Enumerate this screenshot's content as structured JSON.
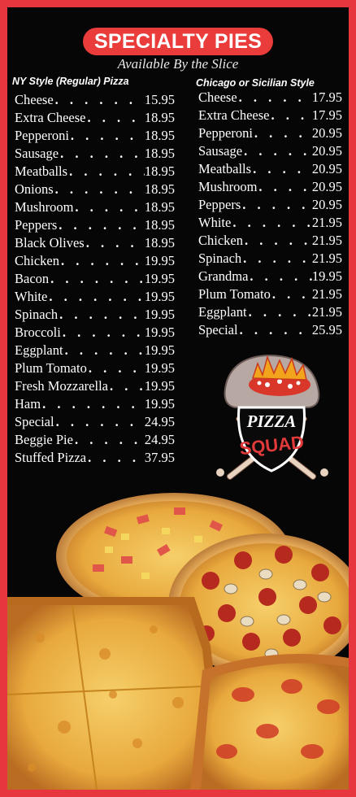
{
  "header": {
    "title": "SPECIALTY PIES",
    "subtitle": "Available By the Slice"
  },
  "ny_style": {
    "heading": "NY Style (Regular) Pizza",
    "items": [
      {
        "name": "Cheese",
        "price": "15.95"
      },
      {
        "name": "Extra Cheese",
        "price": "18.95"
      },
      {
        "name": "Pepperoni",
        "price": "18.95"
      },
      {
        "name": "Sausage",
        "price": "18.95"
      },
      {
        "name": "Meatballs",
        "price": "18.95"
      },
      {
        "name": "Onions",
        "price": "18.95"
      },
      {
        "name": "Mushroom",
        "price": "18.95"
      },
      {
        "name": "Peppers",
        "price": "18.95"
      },
      {
        "name": "Black Olives",
        "price": "18.95"
      },
      {
        "name": "Chicken",
        "price": "19.95"
      },
      {
        "name": "Bacon",
        "price": "19.95"
      },
      {
        "name": "White",
        "price": "19.95"
      },
      {
        "name": "Spinach",
        "price": "19.95"
      },
      {
        "name": "Broccoli",
        "price": "19.95"
      },
      {
        "name": "Eggplant",
        "price": "19.95"
      },
      {
        "name": "Plum Tomato",
        "price": "19.95"
      },
      {
        "name": "Fresh Mozzarella",
        "price": "19.95"
      },
      {
        "name": "Ham",
        "price": "19.95"
      },
      {
        "name": "Special",
        "price": "24.95"
      },
      {
        "name": "Beggie Pie",
        "price": "24.95"
      },
      {
        "name": "Stuffed Pizza",
        "price": "37.95"
      }
    ]
  },
  "chicago_style": {
    "heading": "Chicago or Sicilian Style",
    "items": [
      {
        "name": "Cheese",
        "price": "17.95"
      },
      {
        "name": "Extra Cheese",
        "price": "17.95"
      },
      {
        "name": "Pepperoni",
        "price": "20.95"
      },
      {
        "name": "Sausage",
        "price": "20.95"
      },
      {
        "name": "Meatballs",
        "price": "20.95"
      },
      {
        "name": "Mushroom",
        "price": "20.95"
      },
      {
        "name": "Peppers",
        "price": "20.95"
      },
      {
        "name": "White",
        "price": "21.95"
      },
      {
        "name": "Chicken",
        "price": "21.95"
      },
      {
        "name": "Spinach",
        "price": "21.95"
      },
      {
        "name": "Grandma",
        "price": "19.95"
      },
      {
        "name": "Plum Tomato",
        "price": "21.95"
      },
      {
        "name": "Eggplant",
        "price": "21.95"
      },
      {
        "name": "Special",
        "price": "25.95"
      }
    ]
  },
  "logo": {
    "text_top": "PIZZA",
    "text_bottom": "SQUAD"
  },
  "colors": {
    "border_red": "#e8363f",
    "background": "#060606",
    "pill_red": "#ea3c3a",
    "text": "#ffffff"
  }
}
